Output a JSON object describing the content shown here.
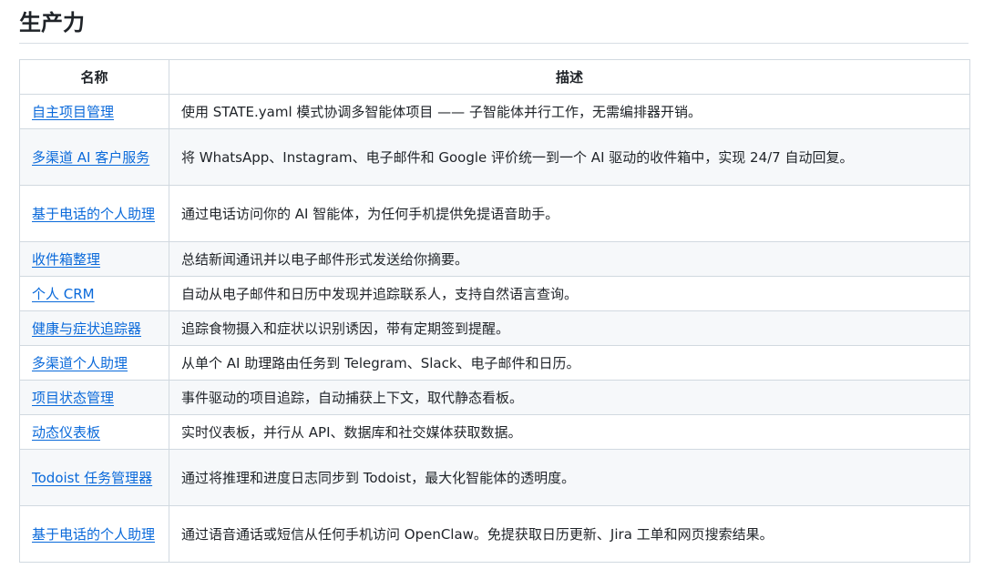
{
  "section": {
    "title": "生产力"
  },
  "table": {
    "headers": {
      "name": "名称",
      "description": "描述"
    },
    "rows": [
      {
        "name": "自主项目管理",
        "description": "使用 STATE.yaml 模式协调多智能体项目 —— 子智能体并行工作，无需编排器开销。"
      },
      {
        "name": "多渠道 AI 客户服务",
        "description": "将 WhatsApp、Instagram、电子邮件和 Google 评价统一到一个 AI 驱动的收件箱中，实现 24/7 自动回复。"
      },
      {
        "name": "基于电话的个人助理",
        "description": "通过电话访问你的 AI 智能体，为任何手机提供免提语音助手。"
      },
      {
        "name": "收件箱整理",
        "description": "总结新闻通讯并以电子邮件形式发送给你摘要。"
      },
      {
        "name": "个人 CRM",
        "description": "自动从电子邮件和日历中发现并追踪联系人，支持自然语言查询。"
      },
      {
        "name": "健康与症状追踪器",
        "description": "追踪食物摄入和症状以识别诱因，带有定期签到提醒。"
      },
      {
        "name": "多渠道个人助理",
        "description": "从单个 AI 助理路由任务到 Telegram、Slack、电子邮件和日历。"
      },
      {
        "name": "项目状态管理",
        "description": "事件驱动的项目追踪，自动捕获上下文，取代静态看板。"
      },
      {
        "name": "动态仪表板",
        "description": "实时仪表板，并行从 API、数据库和社交媒体获取数据。"
      },
      {
        "name": "Todoist 任务管理器",
        "description": "通过将推理和进度日志同步到 Todoist，最大化智能体的透明度。"
      },
      {
        "name": "基于电话的个人助理",
        "description": "通过语音通话或短信从任何手机访问 OpenClaw。免提获取日历更新、Jira 工单和网页搜索结果。"
      }
    ]
  }
}
